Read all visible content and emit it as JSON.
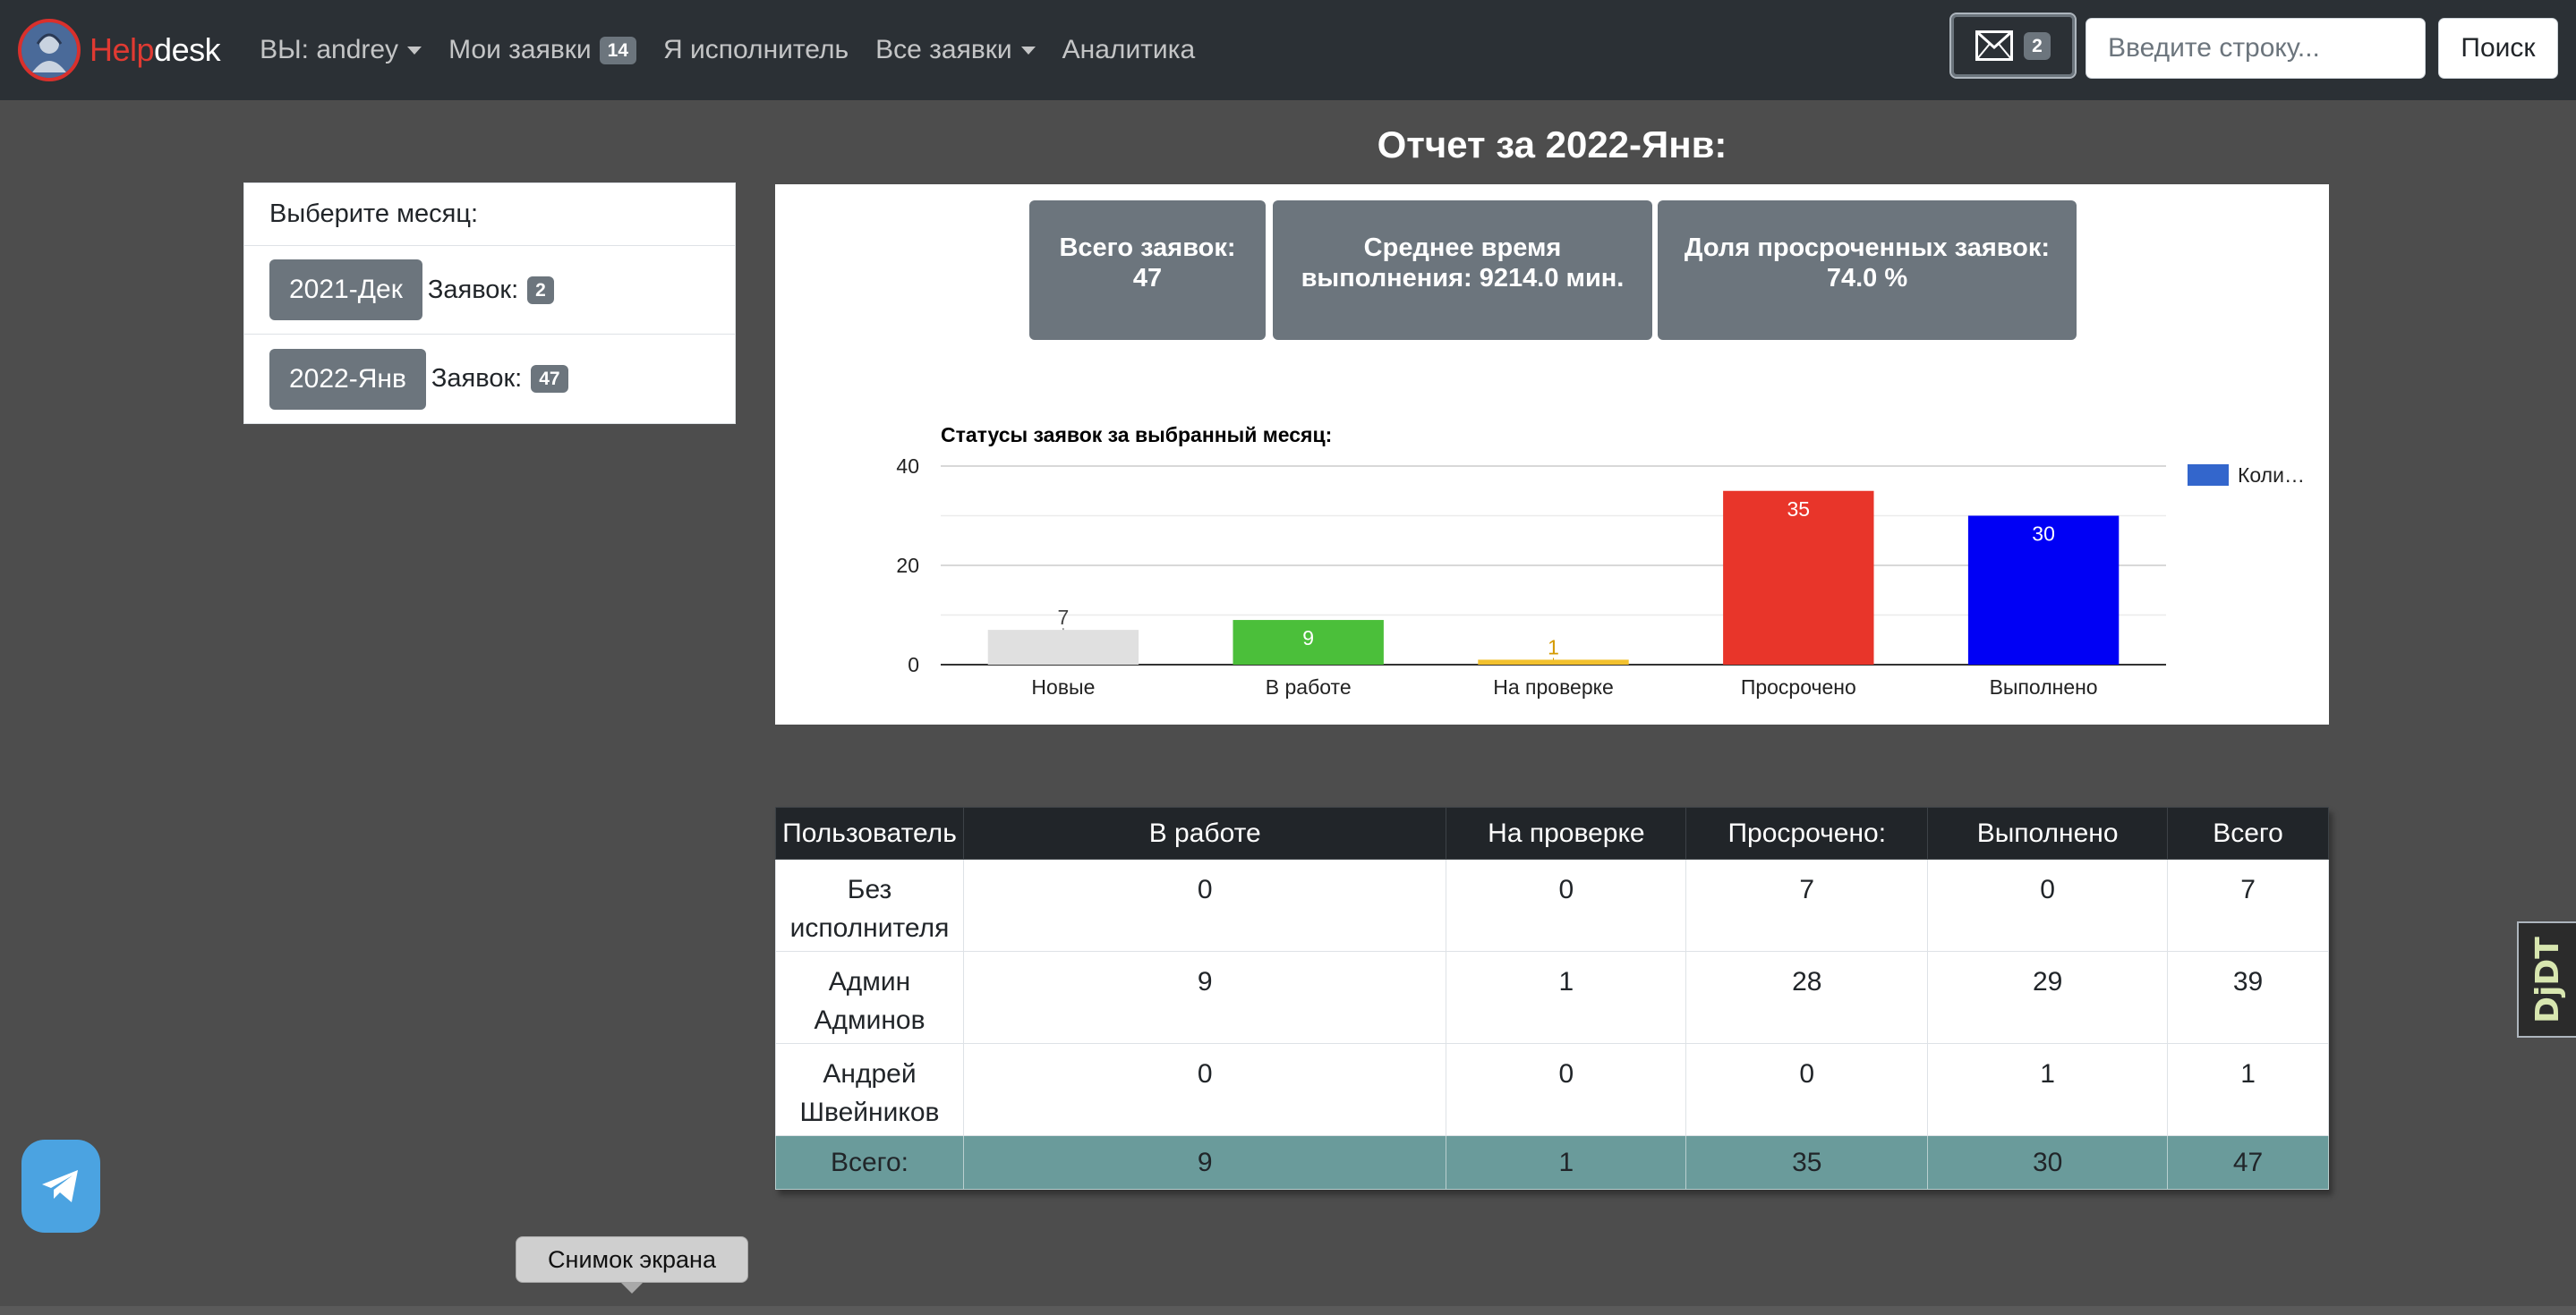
{
  "nav": {
    "brand_red": "Help",
    "brand_white": "desk",
    "user_menu": "ВЫ: andrey",
    "my_tickets": "Мои заявки",
    "my_tickets_count": "14",
    "executor": "Я исполнитель",
    "all_tickets": "Все заявки",
    "analytics": "Аналитика",
    "mail_count": "2",
    "search_placeholder": "Введите строку...",
    "search_button": "Поиск"
  },
  "report": {
    "title": "Отчет за 2022-Янв:"
  },
  "months": {
    "header": "Выберите месяц:",
    "items": [
      {
        "label": "2021-Дек",
        "text": "Заявок:",
        "count": "2"
      },
      {
        "label": "2022-Янв",
        "text": "Заявок:",
        "count": "47"
      }
    ]
  },
  "stats": {
    "total_label": "Всего заявок:",
    "total_value": "47",
    "avg_label_1": "Среднее время",
    "avg_label_2": "выполнения: 9214.0 мин.",
    "overdue_label": "Доля просроченных заявок:",
    "overdue_value": "74.0 %"
  },
  "chart_data": {
    "type": "bar",
    "title": "Статусы заявок за выбранный месяц:",
    "categories": [
      "Новые",
      "В работе",
      "На проверке",
      "Просрочено",
      "Выполнено"
    ],
    "values": [
      7,
      9,
      1,
      35,
      30
    ],
    "colors": [
      "#e0e0e0",
      "#4bbf3a",
      "#f2c12e",
      "#e8352a",
      "#0000f5"
    ],
    "label_colors": [
      "#444444",
      "#ffffff",
      "#d49a00",
      "#ffffff",
      "#ffffff"
    ],
    "ylim": [
      0,
      40
    ],
    "yticks": [
      0,
      20,
      40
    ],
    "grid": true,
    "legend": {
      "position": "right",
      "label": "Коли…",
      "color": "#3366cc"
    }
  },
  "table": {
    "headers": [
      "Пользователь",
      "В работе",
      "На проверке",
      "Просрочено:",
      "Выполнено",
      "Всего"
    ],
    "rows": [
      {
        "user_1": "Без",
        "user_2": "исполнителя",
        "values": [
          "0",
          "0",
          "7",
          "0",
          "7"
        ]
      },
      {
        "user_1": "Админ",
        "user_2": "Админов",
        "values": [
          "9",
          "1",
          "28",
          "29",
          "39"
        ]
      },
      {
        "user_1": "Андрей",
        "user_2": "Швейников",
        "values": [
          "0",
          "0",
          "0",
          "1",
          "1"
        ]
      }
    ],
    "total": {
      "label": "Всего:",
      "values": [
        "9",
        "1",
        "35",
        "30",
        "47"
      ]
    }
  },
  "floating": {
    "djdt": "DjDT",
    "tooltip": "Снимок экрана"
  }
}
